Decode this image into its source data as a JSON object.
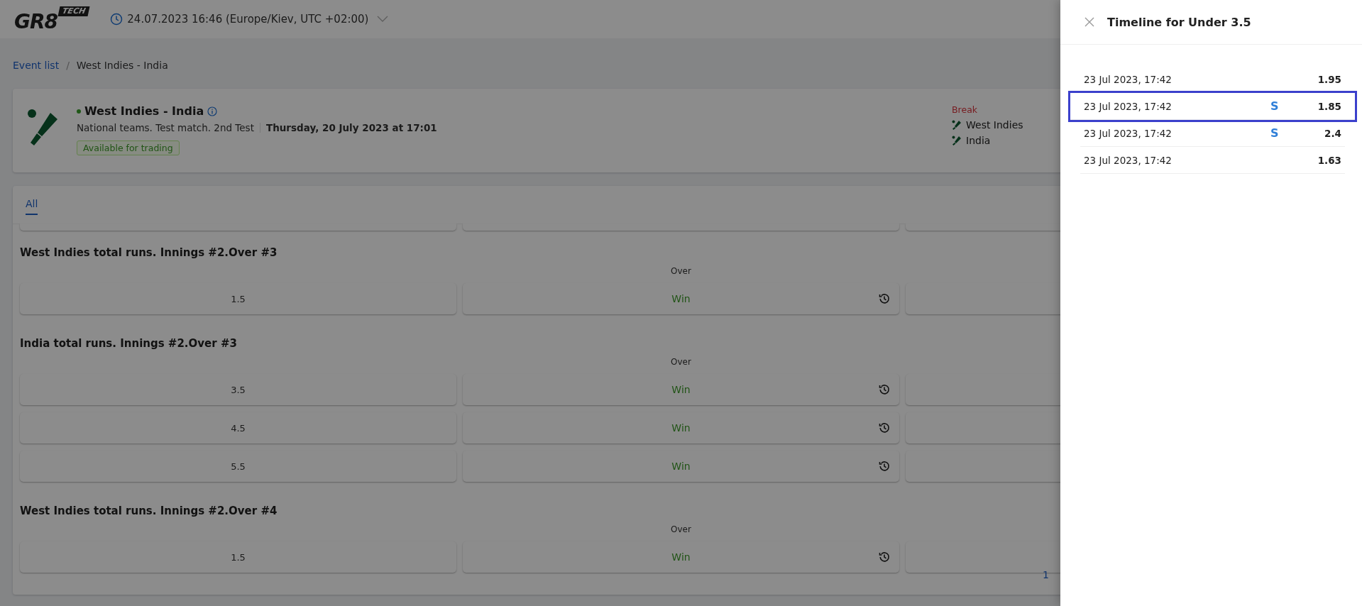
{
  "header": {
    "logo": {
      "main": "GR8",
      "tag": "TECH"
    },
    "datetime": "24.07.2023 16:46 (Europe/Kiev, UTC +02:00)"
  },
  "breadcrumbs": [
    {
      "label": "Event list",
      "link": true
    },
    {
      "label": "West Indies - India",
      "link": false
    }
  ],
  "breadcrumb_separator": "/",
  "event": {
    "live": true,
    "title": "West Indies - India",
    "subtitle": "National teams. Test match. 2nd Test",
    "date": "Thursday, 20 July 2023 at 17:01",
    "badge": "Available for trading",
    "status": "Break",
    "teams": [
      "West Indies",
      "India"
    ]
  },
  "tabs": [
    {
      "label": "All",
      "selected": true
    }
  ],
  "markets": [
    {
      "title": "West Indies total runs. Innings #2.Over #3",
      "column": "Over",
      "rows": [
        {
          "line": "1.5",
          "result": "Win"
        }
      ]
    },
    {
      "title": "India total runs. Innings #2.Over #3",
      "column": "Over",
      "rows": [
        {
          "line": "3.5",
          "result": "Win"
        },
        {
          "line": "4.5",
          "result": "Win"
        },
        {
          "line": "5.5",
          "result": "Win"
        }
      ]
    },
    {
      "title": "West Indies total runs. Innings #2.Over #4",
      "column": "Over",
      "rows": [
        {
          "line": "1.5",
          "result": "Win"
        }
      ]
    }
  ],
  "pagination": "1",
  "drawer": {
    "title": "Timeline for Under 3.5",
    "rows": [
      {
        "time": "23 Jul 2023, 17:42",
        "odds": "1.95",
        "selected": false
      },
      {
        "time": "23 Jul 2023, 17:42",
        "flag": "S",
        "odds": "1.85",
        "selected": true
      },
      {
        "time": "23 Jul 2023, 17:42",
        "flag": "S",
        "odds": "2.4",
        "selected": false
      },
      {
        "time": "23 Jul 2023, 17:42",
        "odds": "1.63",
        "selected": false
      }
    ]
  }
}
